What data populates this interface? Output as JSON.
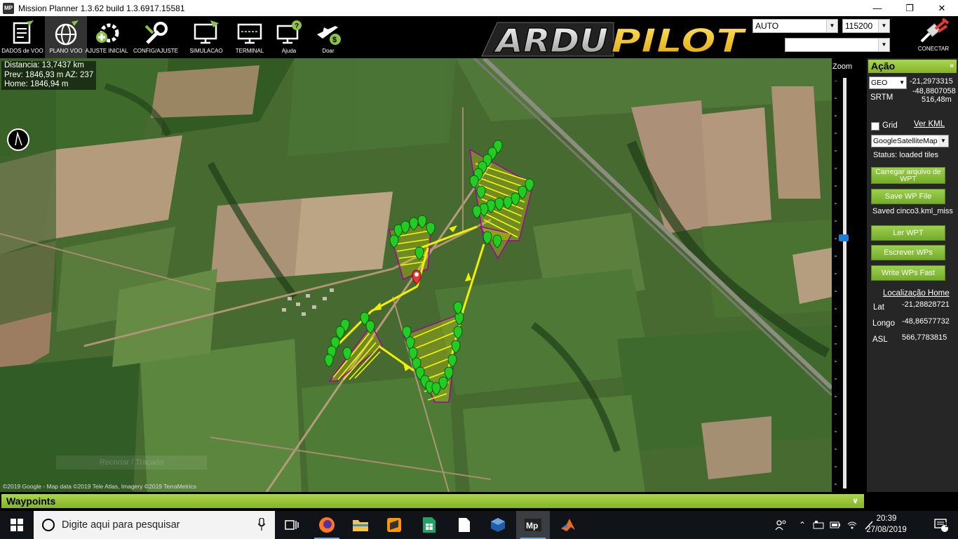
{
  "window": {
    "title": "Mission Planner 1.3.62 build 1.3.6917.15581",
    "app_icon_text": "MP",
    "controls": [
      "minimize",
      "restore",
      "close"
    ]
  },
  "toolbar": {
    "buttons": [
      {
        "label": "DADOS de VOO",
        "icon": "flight-data-icon",
        "active": false
      },
      {
        "label": "PLANO VOO",
        "icon": "flight-plan-globe-icon",
        "active": true
      },
      {
        "label": "AJUSTE INICIAL",
        "icon": "initial-setup-icon",
        "active": false
      },
      {
        "label": "CONFIG/AJUSTE",
        "icon": "config-tuning-icon",
        "active": false
      },
      {
        "label": "SIMULACAO",
        "icon": "simulation-icon",
        "active": false
      },
      {
        "label": "TERMINAL",
        "icon": "terminal-icon",
        "active": false
      },
      {
        "label": "Ajuda",
        "icon": "help-icon",
        "active": false
      },
      {
        "label": "Doar",
        "icon": "donate-icon",
        "active": false
      }
    ],
    "logo_text": "ARDUPILOT",
    "mode_select": "AUTO",
    "baud_select": "115200",
    "port_select": "",
    "connect_label": "CONECTAR"
  },
  "map": {
    "info": {
      "distance": "Distancia: 13,7437 km",
      "prev": "Prev: 1846,93 m AZ: 237",
      "home": "Home: 1846,94 m"
    },
    "watermark": "Recortar / Traçado",
    "copyright": "©2019 Google - Map data ©2019 Tele Atlas, Imagery ©2019 TerraMetrics"
  },
  "zoom": {
    "title": "Zoom",
    "level_fraction": 0.61
  },
  "panel": {
    "title": "Ação",
    "coord_mode": "GEO",
    "lat": "-21,2973315",
    "lng": "-48,8807058",
    "srtm_label": "SRTM",
    "srtm_alt": "516,48m",
    "grid_label": "Grid",
    "kml_link": "Ver KML",
    "map_provider": "GoogleSatelliteMap",
    "status": "Status: loaded tiles",
    "btn_load_wpt": "Carregar arquivo de WPT",
    "btn_save_wp": "Save WP File",
    "saved_text": "Saved cinco3.kml_miss",
    "btn_read_wpt": "Ler WPT",
    "btn_write_wps": "Escrever WPs",
    "btn_write_fast": "Write WPs Fast",
    "home_link": "Localização Home",
    "home_lat_label": "Lat",
    "home_lat": "-21,28828721",
    "home_lng_label": "Longo",
    "home_lng": "-48,86577732",
    "home_asl_label": "ASL",
    "home_asl": "566,7783815"
  },
  "waypoints_bar": {
    "title": "Waypoints"
  },
  "taskbar": {
    "search_placeholder": "Digite aqui para pesquisar",
    "apps": [
      "task-view-icon",
      "firefox-icon",
      "file-explorer-icon",
      "sublime-icon",
      "sheets-icon",
      "notepad-icon",
      "virtualbox-icon",
      "mission-planner-icon",
      "matlab-icon"
    ],
    "time": "20:39",
    "date": "27/08/2019",
    "notifications": "5"
  }
}
